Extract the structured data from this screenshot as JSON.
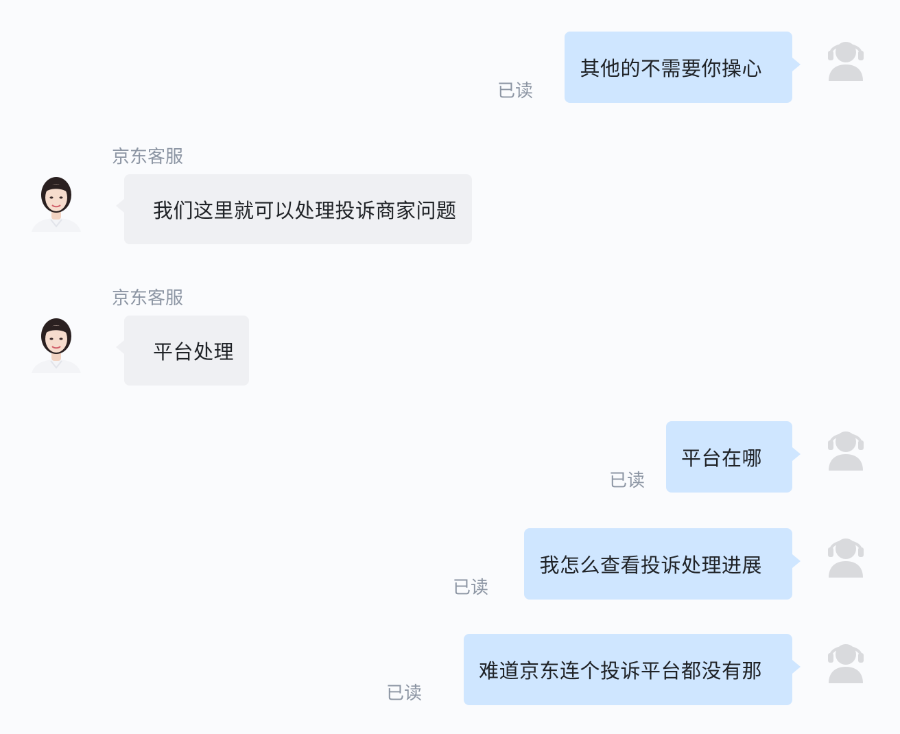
{
  "messages": [
    {
      "side": "out",
      "text": "其他的不需要你操心",
      "status": "已读"
    },
    {
      "side": "in",
      "sender": "京东客服",
      "text": "我们这里就可以处理投诉商家问题"
    },
    {
      "side": "in",
      "sender": "京东客服",
      "text": "平台处理"
    },
    {
      "side": "out",
      "text": "平台在哪",
      "status": "已读"
    },
    {
      "side": "out",
      "text": "我怎么查看投诉处理进展",
      "status": "已读"
    },
    {
      "side": "out",
      "text": "难道京东连个投诉平台都没有那",
      "status": "已读"
    }
  ],
  "icons": {
    "user_avatar": "headset-person-icon",
    "service_avatar": "customer-service-agent-photo"
  },
  "colors": {
    "background": "#fafbfd",
    "outgoing_bubble": "#cfe6ff",
    "incoming_bubble": "#eff0f3",
    "meta_text": "#8c95a3",
    "avatar_grey": "#d9dadd"
  }
}
